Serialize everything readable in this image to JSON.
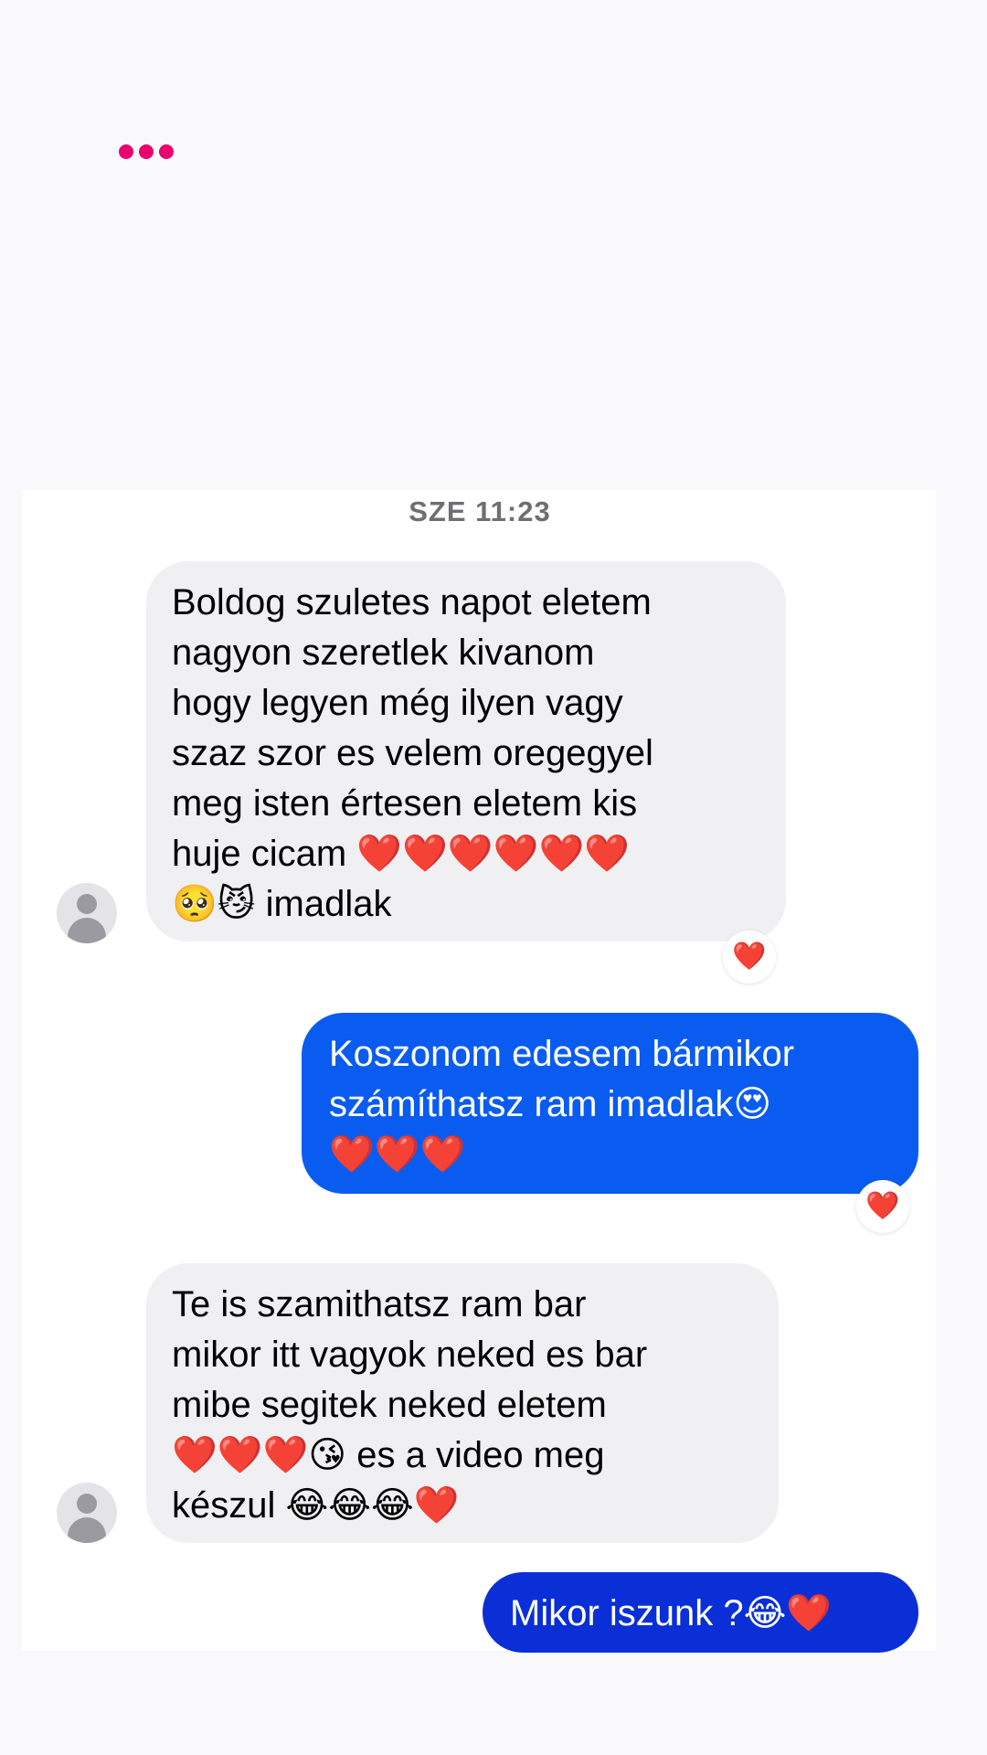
{
  "typing_indicator": {
    "color": "#e8006f"
  },
  "thread": {
    "timestamp": "SZE 11:23",
    "messages": [
      {
        "direction": "incoming",
        "text": "Boldog szuletes napot eletem\nnagyon szeretlek  kivanom\nhogy legyen még ilyen  vagy\nszaz szor  es velem oregegyel\nmeg isten értesen eletem kis\nhuje cicam ❤️❤️❤️❤️❤️❤️\n🥺😼 imadlak",
        "reaction": "❤️"
      },
      {
        "direction": "outgoing",
        "text": "Koszonom edesem bármikor\nszámíthatsz ram imadlak😍\n❤️❤️❤️",
        "reaction": "❤️"
      },
      {
        "direction": "incoming",
        "text": "Te is szamithatsz ram bar\nmikor itt vagyok neked es bar\nmibe segitek neked eletem\n❤️❤️❤️😘 es a video meg\nkészul 😂😂😂❤️"
      },
      {
        "direction": "outgoing",
        "text": "Mikor iszunk ?😂❤️"
      }
    ]
  },
  "colors": {
    "incoming_bubble": "#f0f0f3",
    "outgoing_bubble": "#0a5cf0",
    "outgoing_bubble_last": "#0a2fd6",
    "heart": "#e5161f"
  }
}
